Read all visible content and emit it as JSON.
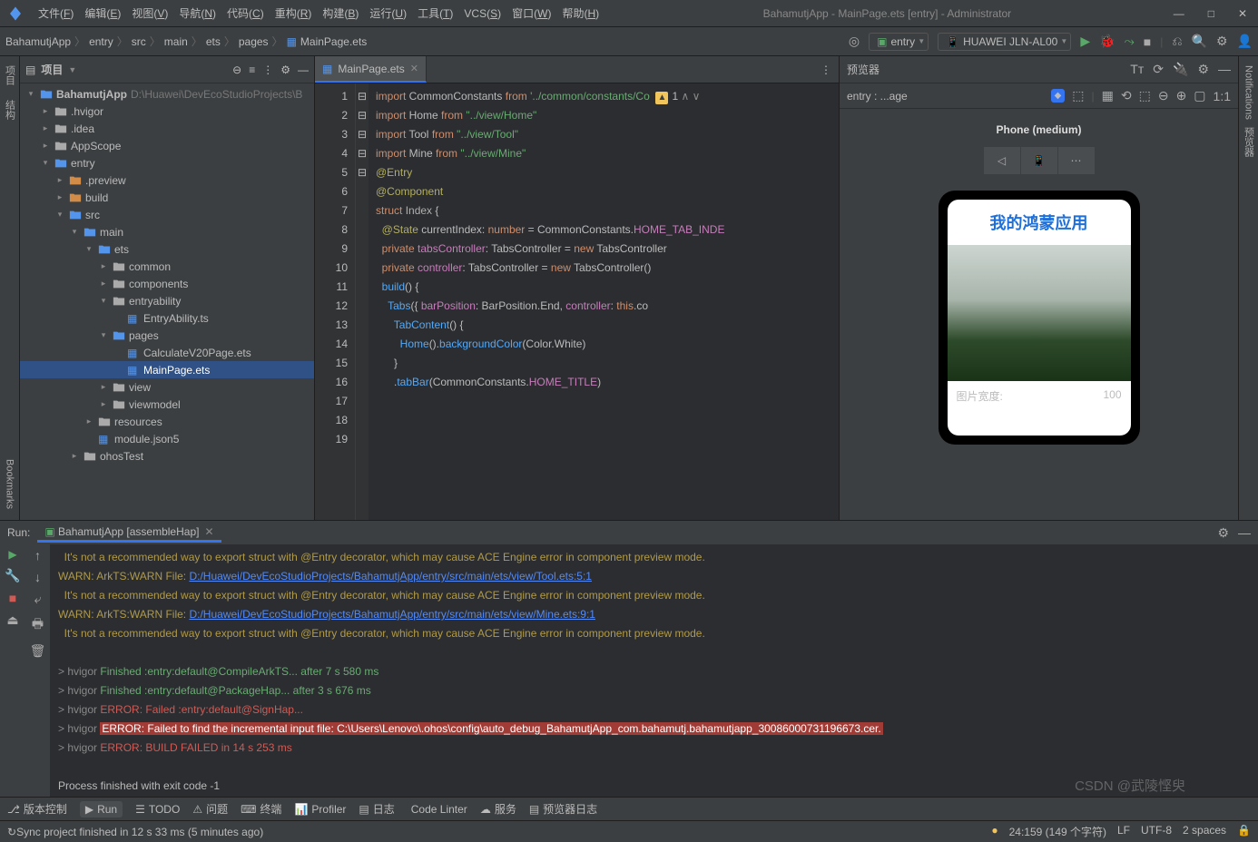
{
  "menu": {
    "items": [
      "文件(F)",
      "编辑(E)",
      "视图(V)",
      "导航(N)",
      "代码(C)",
      "重构(R)",
      "构建(B)",
      "运行(U)",
      "工具(T)",
      "VCS(S)",
      "窗口(W)",
      "帮助(H)"
    ]
  },
  "window_title": "BahamutjApp - MainPage.ets [entry] - Administrator",
  "breadcrumb": [
    "BahamutjApp",
    "entry",
    "src",
    "main",
    "ets",
    "pages",
    "MainPage.ets"
  ],
  "toolbar": {
    "module": "entry",
    "device": "HUAWEI JLN-AL00"
  },
  "project": {
    "panel_title": "项目",
    "root": "BahamutjApp",
    "root_path": "D:\\Huawei\\DevEcoStudioProjects\\B",
    "items": [
      {
        "d": 1,
        "i": "fold",
        "t": ".hvigor"
      },
      {
        "d": 1,
        "i": "fold",
        "t": ".idea"
      },
      {
        "d": 1,
        "i": "fold",
        "t": "AppScope"
      },
      {
        "d": 1,
        "i": "foldb",
        "t": "entry",
        "open": true
      },
      {
        "d": 2,
        "i": "foldo",
        "t": ".preview"
      },
      {
        "d": 2,
        "i": "foldo",
        "t": "build"
      },
      {
        "d": 2,
        "i": "foldb",
        "t": "src",
        "open": true
      },
      {
        "d": 3,
        "i": "foldb",
        "t": "main",
        "open": true
      },
      {
        "d": 4,
        "i": "foldb",
        "t": "ets",
        "open": true
      },
      {
        "d": 5,
        "i": "fold",
        "t": "common"
      },
      {
        "d": 5,
        "i": "fold",
        "t": "components"
      },
      {
        "d": 5,
        "i": "fold",
        "t": "entryability",
        "open": true
      },
      {
        "d": 6,
        "i": "file",
        "t": "EntryAbility.ts"
      },
      {
        "d": 5,
        "i": "foldb",
        "t": "pages",
        "open": true
      },
      {
        "d": 6,
        "i": "file",
        "t": "CalculateV20Page.ets"
      },
      {
        "d": 6,
        "i": "file",
        "t": "MainPage.ets",
        "sel": true
      },
      {
        "d": 5,
        "i": "fold",
        "t": "view"
      },
      {
        "d": 5,
        "i": "fold",
        "t": "viewmodel"
      },
      {
        "d": 4,
        "i": "fold",
        "t": "resources"
      },
      {
        "d": 4,
        "i": "file",
        "t": "module.json5"
      },
      {
        "d": 3,
        "i": "fold",
        "t": "ohosTest"
      }
    ]
  },
  "editor": {
    "tab": "MainPage.ets",
    "warn_count": "1",
    "up": "∧",
    "down": "∨",
    "lines": [
      {
        "n": 1,
        "c": [
          [
            "kw",
            "import"
          ],
          [
            "",
            " CommonConstants "
          ],
          [
            "kw",
            "from"
          ],
          [
            "",
            " "
          ],
          [
            "str",
            "'../common/constants/Co"
          ]
        ]
      },
      {
        "n": 2,
        "c": [
          [
            "kw",
            "import"
          ],
          [
            "",
            " Home "
          ],
          [
            "kw",
            "from"
          ],
          [
            "",
            " "
          ],
          [
            "str",
            "\"../view/Home\""
          ]
        ]
      },
      {
        "n": 3,
        "c": [
          [
            "kw",
            "import"
          ],
          [
            "",
            " Tool "
          ],
          [
            "kw",
            "from"
          ],
          [
            "",
            " "
          ],
          [
            "str",
            "\"../view/Tool\""
          ]
        ]
      },
      {
        "n": 4,
        "c": [
          [
            "kw",
            "import"
          ],
          [
            "",
            " Mine "
          ],
          [
            "kw",
            "from"
          ],
          [
            "",
            " "
          ],
          [
            "str",
            "\"../view/Mine\""
          ]
        ]
      },
      {
        "n": 5,
        "c": [
          [
            "",
            ""
          ]
        ]
      },
      {
        "n": 6,
        "c": [
          [
            "dec",
            "@Entry"
          ]
        ]
      },
      {
        "n": 7,
        "c": [
          [
            "dec",
            "@Component"
          ]
        ]
      },
      {
        "n": 8,
        "c": [
          [
            "kw",
            "struct"
          ],
          [
            "",
            " "
          ],
          [
            "type",
            "Index"
          ],
          [
            "",
            " {"
          ]
        ]
      },
      {
        "n": 9,
        "c": [
          [
            "",
            "  "
          ],
          [
            "dec",
            "@State"
          ],
          [
            "",
            " currentIndex: "
          ],
          [
            "kw",
            "number"
          ],
          [
            "",
            " = CommonConstants."
          ],
          [
            "prop",
            "HOME_TAB_INDE"
          ]
        ]
      },
      {
        "n": 10,
        "c": [
          [
            "",
            "  "
          ],
          [
            "kw",
            "private"
          ],
          [
            "",
            " "
          ],
          [
            "ident",
            "tabsController"
          ],
          [
            "",
            ": TabsController = "
          ],
          [
            "kw",
            "new"
          ],
          [
            "",
            " TabsController"
          ]
        ]
      },
      {
        "n": 11,
        "c": [
          [
            "",
            "  "
          ],
          [
            "kw",
            "private"
          ],
          [
            "",
            " "
          ],
          [
            "ident",
            "controller"
          ],
          [
            "",
            ": TabsController = "
          ],
          [
            "kw",
            "new"
          ],
          [
            "",
            " TabsController()"
          ]
        ]
      },
      {
        "n": 12,
        "c": [
          [
            "",
            ""
          ]
        ]
      },
      {
        "n": 13,
        "c": [
          [
            "",
            "  "
          ],
          [
            "fn",
            "build"
          ],
          [
            "",
            "() {"
          ]
        ]
      },
      {
        "n": 14,
        "c": [
          [
            "",
            "    "
          ],
          [
            "fn",
            "Tabs"
          ],
          [
            "",
            "({ "
          ],
          [
            "ident",
            "barPosition"
          ],
          [
            "",
            ": BarPosition.End, "
          ],
          [
            "ident",
            "controller"
          ],
          [
            "",
            ": "
          ],
          [
            "kw",
            "this"
          ],
          [
            "",
            ".co"
          ]
        ]
      },
      {
        "n": 15,
        "c": [
          [
            "",
            "      "
          ],
          [
            "fn",
            "TabContent"
          ],
          [
            "",
            "() {"
          ]
        ]
      },
      {
        "n": 16,
        "c": [
          [
            "",
            "        "
          ],
          [
            "fn",
            "Home"
          ],
          [
            "",
            "()."
          ],
          [
            "fn",
            "backgroundColor"
          ],
          [
            "",
            "(Color.White)"
          ]
        ]
      },
      {
        "n": 17,
        "c": [
          [
            "",
            "      }"
          ]
        ]
      },
      {
        "n": 18,
        "c": [
          [
            "",
            "      ."
          ],
          [
            "fn",
            "tabBar"
          ],
          [
            "",
            "(CommonConstants."
          ],
          [
            "prop",
            "HOME_TITLE"
          ],
          [
            "",
            ")"
          ]
        ]
      },
      {
        "n": 19,
        "c": [
          [
            "",
            ""
          ]
        ]
      }
    ]
  },
  "preview": {
    "title": "预览器",
    "path": "entry : ...age",
    "phone": "Phone (medium)",
    "app_title": "我的鸿蒙应用",
    "row_label": "图片宽度:",
    "row_val": "100"
  },
  "run": {
    "label": "Run:",
    "tab": "BahamutjApp [assembleHap]",
    "lines": [
      {
        "t": "warn",
        "txt": "  It's not a recommended way to export struct with @Entry decorator, which may cause ACE Engine error in component preview mode."
      },
      {
        "t": "mix",
        "pre": "WARN: ArkTS:WARN File: ",
        "link": "D:/Huawei/DevEcoStudioProjects/BahamutjApp/entry/src/main/ets/view/Tool.ets:5:1"
      },
      {
        "t": "warn",
        "txt": "  It's not a recommended way to export struct with @Entry decorator, which may cause ACE Engine error in component preview mode."
      },
      {
        "t": "mix",
        "pre": "WARN: ArkTS:WARN File: ",
        "link": "D:/Huawei/DevEcoStudioProjects/BahamutjApp/entry/src/main/ets/view/Mine.ets:9:1"
      },
      {
        "t": "warn",
        "txt": "  It's not a recommended way to export struct with @Entry decorator, which may cause ACE Engine error in component preview mode."
      },
      {
        "t": "blank",
        "txt": ""
      },
      {
        "t": "hv",
        "pre": "> hvigor ",
        "txt": "Finished :entry:default@CompileArkTS... after 7 s 580 ms"
      },
      {
        "t": "hv",
        "pre": "> hvigor ",
        "txt": "Finished :entry:default@PackageHap... after 3 s 676 ms"
      },
      {
        "t": "he",
        "pre": "> hvigor ",
        "txt": "ERROR: Failed :entry:default@SignHap..."
      },
      {
        "t": "hehl",
        "pre": "> hvigor ",
        "txt": "ERROR: Failed to find the incremental input file: C:\\Users\\Lenovo\\.ohos\\config\\auto_debug_BahamutjApp_com.bahamutj.bahamutjapp_30086000731196673.cer."
      },
      {
        "t": "he",
        "pre": "> hvigor ",
        "txt": "ERROR: BUILD FAILED in 14 s 253 ms"
      },
      {
        "t": "blank",
        "txt": ""
      },
      {
        "t": "plain",
        "txt": "Process finished with exit code -1"
      }
    ]
  },
  "bottom": {
    "items": [
      "版本控制",
      "Run",
      "TODO",
      "问题",
      "终端",
      "Profiler",
      "日志",
      "Code Linter",
      "服务",
      "预览器日志"
    ],
    "run_icon": "▶"
  },
  "status": {
    "left": "Sync project finished in 12 s 33 ms (5 minutes ago)",
    "pos": "24:159 (149 个字符)",
    "enc": "LF",
    "enc2": "UTF-8",
    "sp": "2 spaces"
  },
  "watermark": "CSDN @武陵悭臾"
}
